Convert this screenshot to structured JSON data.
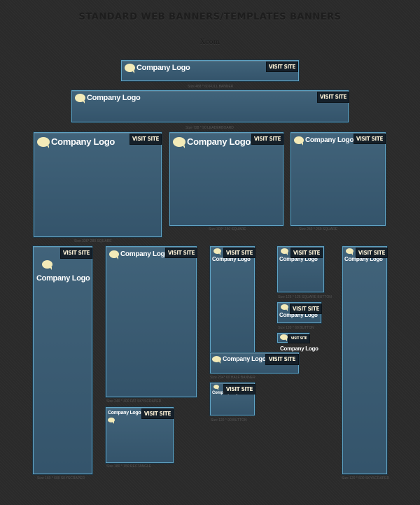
{
  "header": {
    "title": "STANDARD WEB BANNERS/TEMPLATES BANNERS",
    "subtitle": "Xcom"
  },
  "logo_text": "Company Logo",
  "visit_label": "VISIT SITE",
  "colors": {
    "banner": "#3b5c73",
    "border": "#5fa3c4",
    "button": "#15202a",
    "bubble": "#f3eab8",
    "background": "#2a2a2a"
  },
  "banners": [
    {
      "id": "full-banner",
      "caption": "Size 468 * 60 FULL BANNER"
    },
    {
      "id": "leaderboard",
      "caption": "Size 728 * 90 LEADERBOARD"
    },
    {
      "id": "square-336",
      "caption": "Size 336* 280 SQUARE"
    },
    {
      "id": "square-300",
      "caption": "Size 300* 250 SQUARE"
    },
    {
      "id": "square-250",
      "caption": "Size 250 * 250 SQUARE"
    },
    {
      "id": "skyscraper-160",
      "caption": "Size 160 * 600 SKYSCRAPER"
    },
    {
      "id": "fat-skyscraper",
      "caption": "Size 240 * 400 FAT SKYSCRAPER"
    },
    {
      "id": "small-skyscraper",
      "caption": "Size 120 * 240 SMALL SKYSCRAPER"
    },
    {
      "id": "square-button",
      "caption": "Size 125 * 125 SQUARE BUTTON"
    },
    {
      "id": "button-120x60",
      "caption": "Size 120 * 60 BUTTON"
    },
    {
      "id": "micro-button",
      "caption": ""
    },
    {
      "id": "half-banner",
      "caption": "Size 234* 60 HALF BANNER"
    },
    {
      "id": "button-120x90",
      "caption": "Size 120 * 90 BUTTON"
    },
    {
      "id": "rectangle",
      "caption": "Size 180 * 150 RECTANGLE"
    },
    {
      "id": "skyscraper-120",
      "caption": "Size 120 * 600 SKYSCRAPER"
    }
  ]
}
